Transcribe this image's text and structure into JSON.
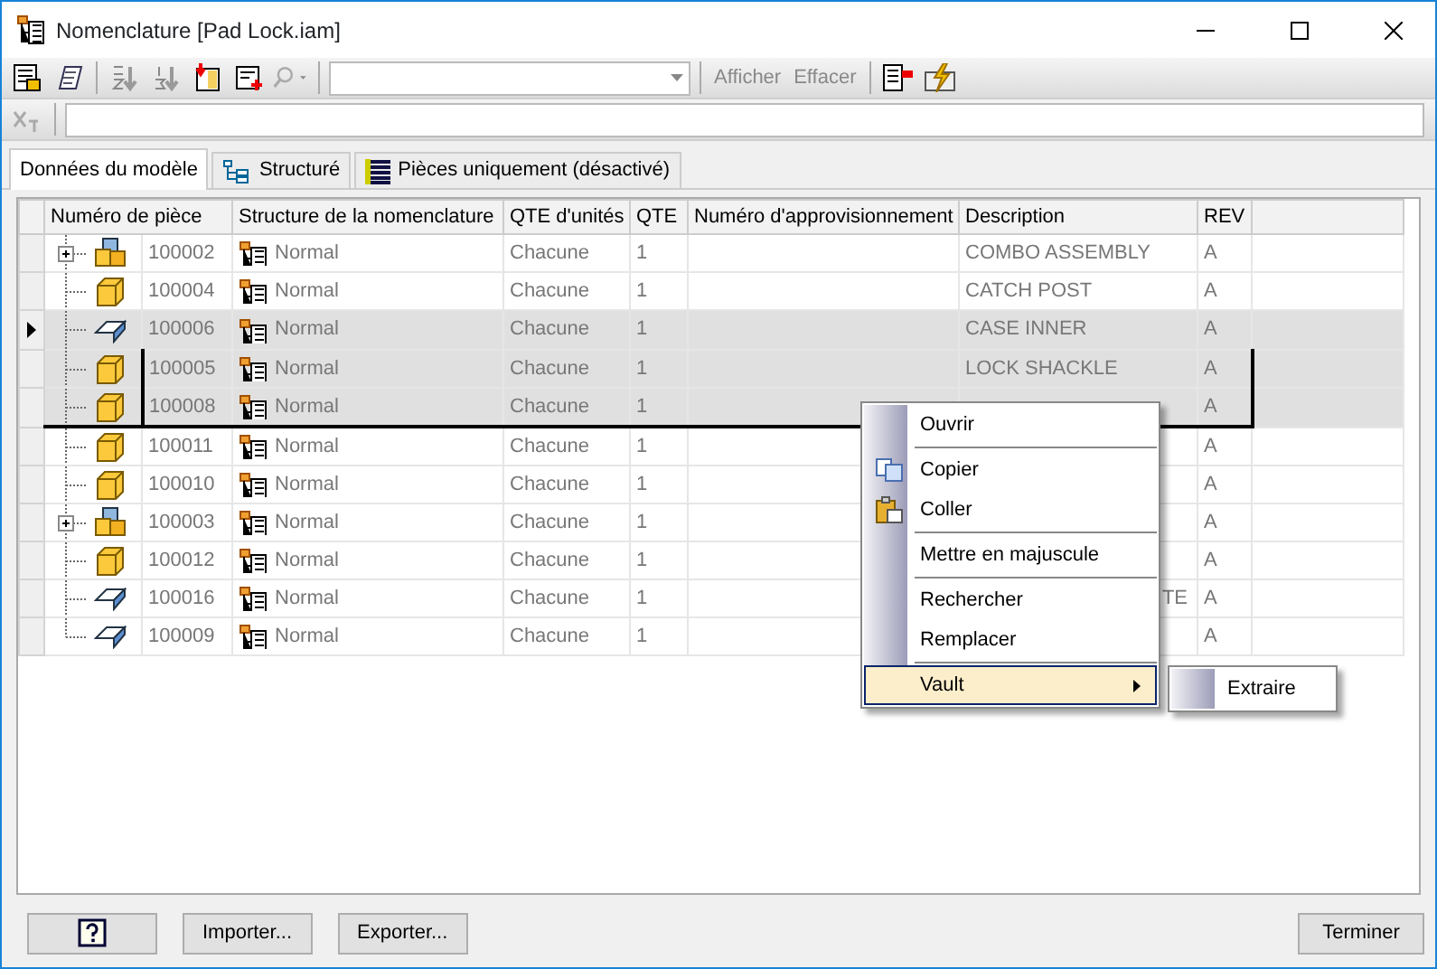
{
  "window": {
    "title": "Nomenclature [Pad Lock.iam]"
  },
  "toolbar": {
    "text_buttons": [
      {
        "label": "Afficher",
        "disabled": true
      },
      {
        "label": "Effacer",
        "disabled": true
      }
    ]
  },
  "tabs": [
    {
      "label": "Données du modèle",
      "selected": true
    },
    {
      "label": "Structuré",
      "selected": false
    },
    {
      "label": "Pièces uniquement (désactivé)",
      "selected": false
    }
  ],
  "table": {
    "columns": [
      "Numéro de pièce",
      "Structure de la nomenclature",
      "QTE d'unités",
      "QTE",
      "Numéro d'approvisionnement",
      "Description",
      "REV"
    ],
    "rows": [
      {
        "kind": "assembly",
        "expandable": true,
        "part": "100002",
        "structure": "Normal",
        "units": "Chacune",
        "qty": "1",
        "description": "COMBO ASSEMBLY",
        "rev": "A",
        "selected": false,
        "current": false
      },
      {
        "kind": "part",
        "expandable": false,
        "part": "100004",
        "structure": "Normal",
        "units": "Chacune",
        "qty": "1",
        "description": "CATCH POST",
        "rev": "A",
        "selected": false,
        "current": false
      },
      {
        "kind": "sheet",
        "expandable": false,
        "part": "100006",
        "structure": "Normal",
        "units": "Chacune",
        "qty": "1",
        "description": "CASE INNER",
        "rev": "A",
        "selected": true,
        "current": true
      },
      {
        "kind": "part",
        "expandable": false,
        "part": "100005",
        "structure": "Normal",
        "units": "Chacune",
        "qty": "1",
        "description": "LOCK SHACKLE",
        "rev": "A",
        "selected": true,
        "current": false
      },
      {
        "kind": "part",
        "expandable": false,
        "part": "100008",
        "structure": "Normal",
        "units": "Chacune",
        "qty": "1",
        "rev": "A",
        "selected": true,
        "current": false
      },
      {
        "kind": "part",
        "expandable": false,
        "part": "100011",
        "structure": "Normal",
        "units": "Chacune",
        "qty": "1",
        "rev": "A",
        "selected": false,
        "current": false
      },
      {
        "kind": "part",
        "expandable": false,
        "part": "100010",
        "structure": "Normal",
        "units": "Chacune",
        "qty": "1",
        "rev": "A",
        "selected": false,
        "current": false
      },
      {
        "kind": "assembly",
        "expandable": true,
        "part": "100003",
        "structure": "Normal",
        "units": "Chacune",
        "qty": "1",
        "rev": "A",
        "selected": false,
        "current": false
      },
      {
        "kind": "part",
        "expandable": false,
        "part": "100012",
        "structure": "Normal",
        "units": "Chacune",
        "qty": "1",
        "rev": "A",
        "selected": false,
        "current": false
      },
      {
        "kind": "sheet",
        "expandable": false,
        "part": "100016",
        "structure": "Normal",
        "units": "Chacune",
        "qty": "1",
        "description": "TE",
        "rev": "A",
        "selected": false,
        "current": false
      },
      {
        "kind": "sheet",
        "expandable": false,
        "part": "100009",
        "structure": "Normal",
        "units": "Chacune",
        "qty": "1",
        "rev": "A",
        "selected": false,
        "current": false
      }
    ]
  },
  "context_menu": {
    "items": [
      {
        "kind": "item",
        "label": "Ouvrir"
      },
      {
        "kind": "separator"
      },
      {
        "kind": "copy",
        "label": "Copier"
      },
      {
        "kind": "paste",
        "label": "Coller"
      },
      {
        "kind": "separator"
      },
      {
        "kind": "item",
        "label": "Mettre en majuscule"
      },
      {
        "kind": "separator"
      },
      {
        "kind": "item",
        "label": "Rechercher"
      },
      {
        "kind": "item",
        "label": "Remplacer"
      },
      {
        "kind": "separator"
      },
      {
        "kind": "submenu",
        "label": "Vault",
        "highlighted": true
      }
    ],
    "submenu": [
      {
        "label": "Extraire"
      }
    ]
  },
  "buttons": [
    {
      "kind": "help"
    },
    {
      "kind": "text",
      "label": "Importer..."
    },
    {
      "kind": "text",
      "label": "Exporter..."
    },
    {
      "kind": "spacer"
    },
    {
      "kind": "text",
      "label": "Terminer"
    }
  ]
}
